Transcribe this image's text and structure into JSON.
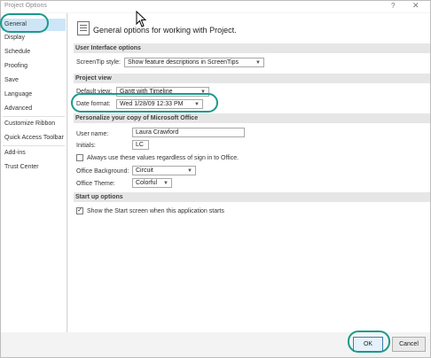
{
  "window": {
    "title": "Project Options",
    "help_glyph": "?",
    "close_glyph": "✕"
  },
  "sidebar": {
    "items": [
      {
        "label": "General",
        "active": true
      },
      {
        "label": "Display"
      },
      {
        "label": "Schedule"
      },
      {
        "label": "Proofing"
      },
      {
        "label": "Save"
      },
      {
        "label": "Language"
      },
      {
        "label": "Advanced"
      },
      {
        "label": "Customize Ribbon"
      },
      {
        "label": "Quick Access Toolbar"
      },
      {
        "label": "Add-ins"
      },
      {
        "label": "Trust Center"
      }
    ]
  },
  "main": {
    "header": "General options for working with Project.",
    "sections": {
      "ui_options": "User Interface options",
      "project_view": "Project view",
      "personalize": "Personalize your copy of Microsoft Office",
      "startup": "Start up options"
    },
    "screentip": {
      "label": "ScreenTip style:",
      "value": "Show feature descriptions in ScreenTips"
    },
    "default_view": {
      "label": "Default view:",
      "value": "Gantt with Timeline"
    },
    "date_format": {
      "label": "Date format:",
      "value": "Wed 1/28/09 12:33 PM"
    },
    "user_name": {
      "label": "User name:",
      "value": "Laura Crawford"
    },
    "initials": {
      "label": "Initials:",
      "value": "LC"
    },
    "always_use": {
      "label": "Always use these values regardless of sign in to Office.",
      "checked": false
    },
    "office_background": {
      "label": "Office Background:",
      "value": "Circuit"
    },
    "office_theme": {
      "label": "Office Theme:",
      "value": "Colorful"
    },
    "show_start": {
      "label": "Show the Start screen when this application starts",
      "checked": true,
      "check_glyph": "✓"
    }
  },
  "footer": {
    "ok": "OK",
    "cancel": "Cancel"
  },
  "colors": {
    "callout": "#1b9a8a",
    "active_item": "#cde6f7"
  }
}
